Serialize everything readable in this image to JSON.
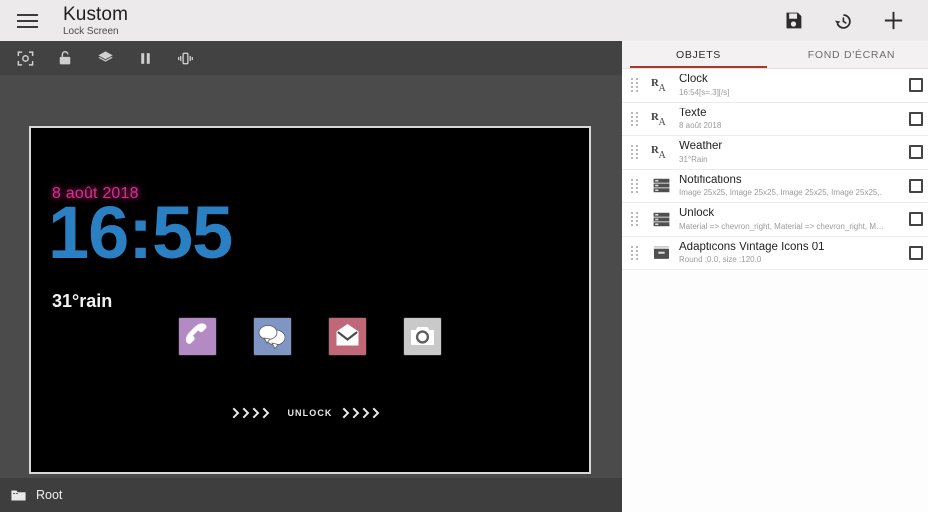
{
  "appbar": {
    "menu_icon": "hamburger-icon",
    "title": "Kustom",
    "subtitle": "Lock Screen",
    "actions": [
      {
        "name": "save-icon",
        "label": "Save"
      },
      {
        "name": "history-icon",
        "label": "History"
      },
      {
        "name": "add-icon",
        "label": "Add"
      }
    ]
  },
  "toolbar": {
    "items": [
      {
        "name": "screenshot-icon",
        "label": "Screenshot"
      },
      {
        "name": "unlock-icon",
        "label": "Unlock"
      },
      {
        "name": "layers-icon",
        "label": "Layers"
      },
      {
        "name": "pause-icon",
        "label": "Pause"
      },
      {
        "name": "vibrate-icon",
        "label": "Vibrate"
      }
    ]
  },
  "preview": {
    "date": "8 août 2018",
    "time": "16:55",
    "weather": "31°rain",
    "unlock_label": "UNLOCK",
    "chevrons": "››››",
    "app_icons": [
      {
        "name": "phone-icon",
        "label": "Phone",
        "color": "#b48ac4"
      },
      {
        "name": "messages-icon",
        "label": "Messages",
        "color": "#7f95c4"
      },
      {
        "name": "mail-icon",
        "label": "Mail",
        "color": "#c06878"
      },
      {
        "name": "camera-icon",
        "label": "Camera",
        "color": "#c9c9c9"
      }
    ],
    "colors": {
      "date": "#d62f8c",
      "time": "#2a80c2",
      "weather": "#f2f2f2",
      "background": "#000000"
    }
  },
  "bottombar": {
    "folder_icon": "folder-icon",
    "path": "Root"
  },
  "right_panel": {
    "tabs": [
      {
        "label": "OBJETS",
        "active": true
      },
      {
        "label": "FOND D'ÉCRAN",
        "active": false
      }
    ],
    "active_tab_color": "#a5392a",
    "layers": [
      {
        "title": "Clock",
        "subtitle": "16:54[s=.3][/s]",
        "icon": "text-layer-icon",
        "checked": false
      },
      {
        "title": "Texte",
        "subtitle": "8 août 2018",
        "icon": "text-layer-icon",
        "checked": false
      },
      {
        "title": "Weather",
        "subtitle": "31°Rain",
        "icon": "text-layer-icon",
        "checked": false
      },
      {
        "title": "Notifications",
        "subtitle": "Image 25x25, Image 25x25, Image 25x25, Image 25x25,.",
        "icon": "stack-layer-icon",
        "checked": false
      },
      {
        "title": "Unlock",
        "subtitle": "Material => chevron_right, Material => chevron_right, Ma..",
        "icon": "stack-layer-icon",
        "checked": false
      },
      {
        "title": "Adapticons Vintage Icons 01",
        "subtitle": "Round :0.0, size :120.0",
        "icon": "overlap-layer-icon",
        "checked": false
      }
    ]
  }
}
